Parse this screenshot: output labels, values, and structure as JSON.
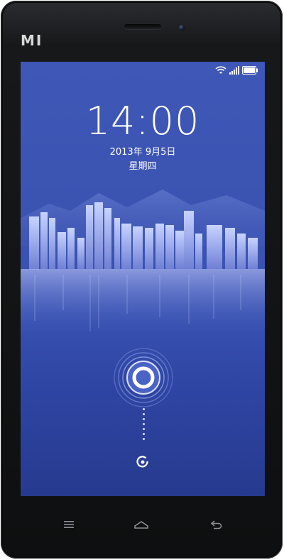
{
  "device": {
    "brand_label": "MI"
  },
  "lockscreen": {
    "time": "14:00",
    "date": "2013年 9月5日",
    "weekday": "星期四"
  },
  "status_bar": {
    "icons": [
      "wifi-icon",
      "signal-icon",
      "battery-icon"
    ]
  },
  "unlock": {
    "icon": "unlock-ring-icon",
    "hint_icon": "camera-shortcut-icon"
  },
  "nav_bar": {
    "items": [
      "menu-icon",
      "home-icon",
      "back-icon"
    ]
  },
  "colors": {
    "screen_top": "#3f57b6",
    "screen_bottom": "#263a8e",
    "bezel": "#121314"
  }
}
